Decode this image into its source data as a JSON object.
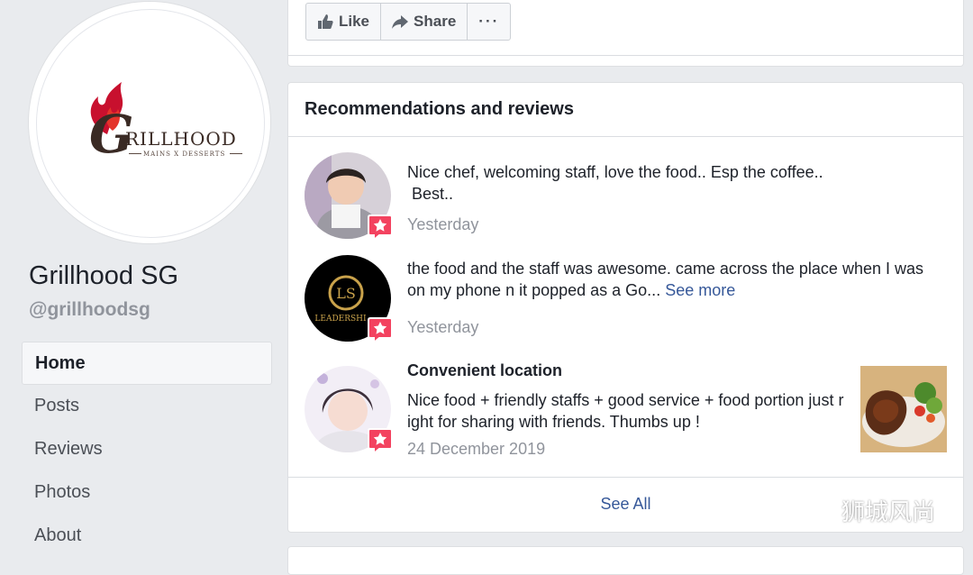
{
  "page": {
    "name": "Grillhood SG",
    "handle": "@grillhoodsg",
    "logo": {
      "brand": "RILLHOOD",
      "tagline": "MAINS X DESSERTS",
      "mark": "G"
    }
  },
  "nav": {
    "items": [
      "Home",
      "Posts",
      "Reviews",
      "Photos",
      "About"
    ],
    "active": "Home"
  },
  "actions": {
    "like": "Like",
    "share": "Share",
    "more": "···"
  },
  "reviews": {
    "title": "Recommendations and reviews",
    "items": [
      {
        "title": "",
        "text_line1": "Nice chef, welcoming staff, love the food.. Esp the coffee..",
        "text_line2": " Best..",
        "time": "Yesterday"
      },
      {
        "title": "",
        "text_line1": "the food and the staff was awesome. came across the place when I was",
        "text_line2": "on my phone n it popped as a Go...",
        "see_more": "See more",
        "time": "Yesterday"
      },
      {
        "title": "Convenient location",
        "text_line1": "Nice food + friendly staffs + good service + food portion just r",
        "text_line2": "ight for sharing with friends.  Thumbs up !",
        "time": "24 December 2019"
      }
    ],
    "avatar2_text": "LS",
    "avatar2_sub": "LEADERSHI",
    "see_all": "See All"
  },
  "watermark": "狮城风尚",
  "colors": {
    "link": "#365899",
    "badge": "#f3425f",
    "bg": "#e9ebee"
  }
}
